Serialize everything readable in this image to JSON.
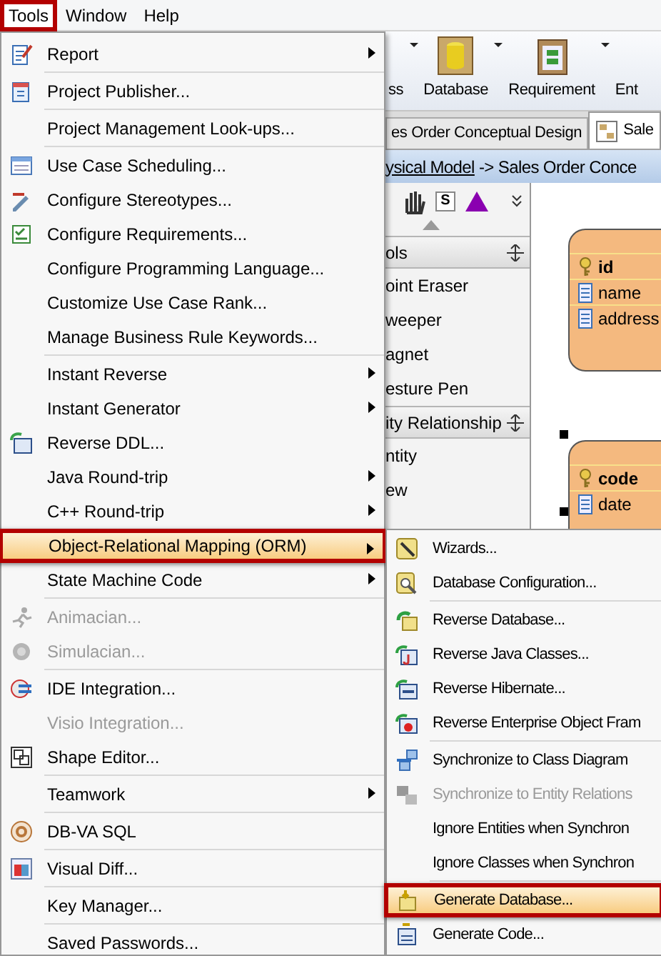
{
  "menubar": [
    {
      "label": "Tools",
      "selected": true
    },
    {
      "label": "Window",
      "selected": false
    },
    {
      "label": "Help",
      "selected": false
    }
  ],
  "toolbar": [
    {
      "label": "ss",
      "has_dropdown": true
    },
    {
      "label": "Database",
      "has_dropdown": true
    },
    {
      "label": "Requirement",
      "has_dropdown": true
    },
    {
      "label": "Ent",
      "has_dropdown": false
    }
  ],
  "tabs": [
    {
      "label": "es Order Conceptual Design",
      "selected": false
    },
    {
      "label": "Sale",
      "selected": true
    }
  ],
  "breadcrumb": {
    "link": "ysical Model",
    "text": "-> Sales Order Conce"
  },
  "palette": {
    "tool_letter": "S",
    "groups": [
      {
        "title": "ols",
        "items": [
          "oint Eraser",
          "weeper",
          "agnet",
          "esture Pen"
        ]
      },
      {
        "title": "ity Relationship",
        "items": [
          "ntity",
          "ew"
        ]
      }
    ]
  },
  "entities": [
    {
      "fields": [
        {
          "name": "id",
          "kind": "key"
        },
        {
          "name": "name",
          "kind": "column"
        },
        {
          "name": "address",
          "kind": "column"
        }
      ]
    },
    {
      "fields": [
        {
          "name": "code",
          "kind": "key"
        },
        {
          "name": "date",
          "kind": "column"
        }
      ]
    }
  ],
  "tools_menu": {
    "groups": [
      [
        {
          "label": "Report",
          "submenu": true,
          "selected": false,
          "disabled": false
        }
      ],
      [
        {
          "label": "Project Publisher...",
          "submenu": false,
          "selected": false,
          "disabled": false
        }
      ],
      [
        {
          "label": "Project Management Look-ups...",
          "submenu": false,
          "selected": false,
          "disabled": false
        }
      ],
      [
        {
          "label": "Use Case Scheduling...",
          "submenu": false,
          "selected": false,
          "disabled": false
        },
        {
          "label": "Configure Stereotypes...",
          "submenu": false,
          "selected": false,
          "disabled": false
        },
        {
          "label": "Configure Requirements...",
          "submenu": false,
          "selected": false,
          "disabled": false
        },
        {
          "label": "Configure Programming Language...",
          "submenu": false,
          "selected": false,
          "disabled": false
        },
        {
          "label": "Customize Use Case Rank...",
          "submenu": false,
          "selected": false,
          "disabled": false
        },
        {
          "label": "Manage Business Rule Keywords...",
          "submenu": false,
          "selected": false,
          "disabled": false
        }
      ],
      [
        {
          "label": "Instant Reverse",
          "submenu": true,
          "selected": false,
          "disabled": false
        },
        {
          "label": "Instant Generator",
          "submenu": true,
          "selected": false,
          "disabled": false
        },
        {
          "label": "Reverse DDL...",
          "submenu": false,
          "selected": false,
          "disabled": false
        },
        {
          "label": "Java Round-trip",
          "submenu": true,
          "selected": false,
          "disabled": false
        },
        {
          "label": "C++ Round-trip",
          "submenu": true,
          "selected": false,
          "disabled": false
        },
        {
          "label": "Object-Relational Mapping (ORM)",
          "submenu": true,
          "selected": true,
          "disabled": false
        },
        {
          "label": "State Machine Code",
          "submenu": true,
          "selected": false,
          "disabled": false
        }
      ],
      [
        {
          "label": "Animacian...",
          "submenu": false,
          "selected": false,
          "disabled": true
        },
        {
          "label": "Simulacian...",
          "submenu": false,
          "selected": false,
          "disabled": true
        }
      ],
      [
        {
          "label": "IDE Integration...",
          "submenu": false,
          "selected": false,
          "disabled": false
        },
        {
          "label": "Visio Integration...",
          "submenu": false,
          "selected": false,
          "disabled": true
        },
        {
          "label": "Shape Editor...",
          "submenu": false,
          "selected": false,
          "disabled": false
        }
      ],
      [
        {
          "label": "Teamwork",
          "submenu": true,
          "selected": false,
          "disabled": false
        }
      ],
      [
        {
          "label": "DB-VA SQL",
          "submenu": false,
          "selected": false,
          "disabled": false
        }
      ],
      [
        {
          "label": "Visual Diff...",
          "submenu": false,
          "selected": false,
          "disabled": false
        }
      ],
      [
        {
          "label": "Key Manager...",
          "submenu": false,
          "selected": false,
          "disabled": false
        }
      ],
      [
        {
          "label": "Saved Passwords...",
          "submenu": false,
          "selected": false,
          "disabled": false
        }
      ]
    ]
  },
  "orm_submenu": {
    "groups": [
      [
        {
          "label": "Wizards...",
          "selected": false,
          "disabled": false
        },
        {
          "label": "Database Configuration...",
          "selected": false,
          "disabled": false
        }
      ],
      [
        {
          "label": "Reverse Database...",
          "selected": false,
          "disabled": false
        },
        {
          "label": "Reverse Java Classes...",
          "selected": false,
          "disabled": false
        },
        {
          "label": "Reverse Hibernate...",
          "selected": false,
          "disabled": false
        },
        {
          "label": "Reverse Enterprise Object Fram",
          "selected": false,
          "disabled": false
        }
      ],
      [
        {
          "label": "Synchronize to Class Diagram",
          "selected": false,
          "disabled": false
        },
        {
          "label": "Synchronize to Entity Relations",
          "selected": false,
          "disabled": true
        },
        {
          "label": "Ignore Entities when Synchron",
          "selected": false,
          "disabled": false
        },
        {
          "label": "Ignore Classes when Synchron",
          "selected": false,
          "disabled": false
        }
      ],
      [
        {
          "label": "Generate Database...",
          "selected": true,
          "disabled": false
        },
        {
          "label": "Generate Code...",
          "selected": false,
          "disabled": false
        }
      ]
    ]
  }
}
